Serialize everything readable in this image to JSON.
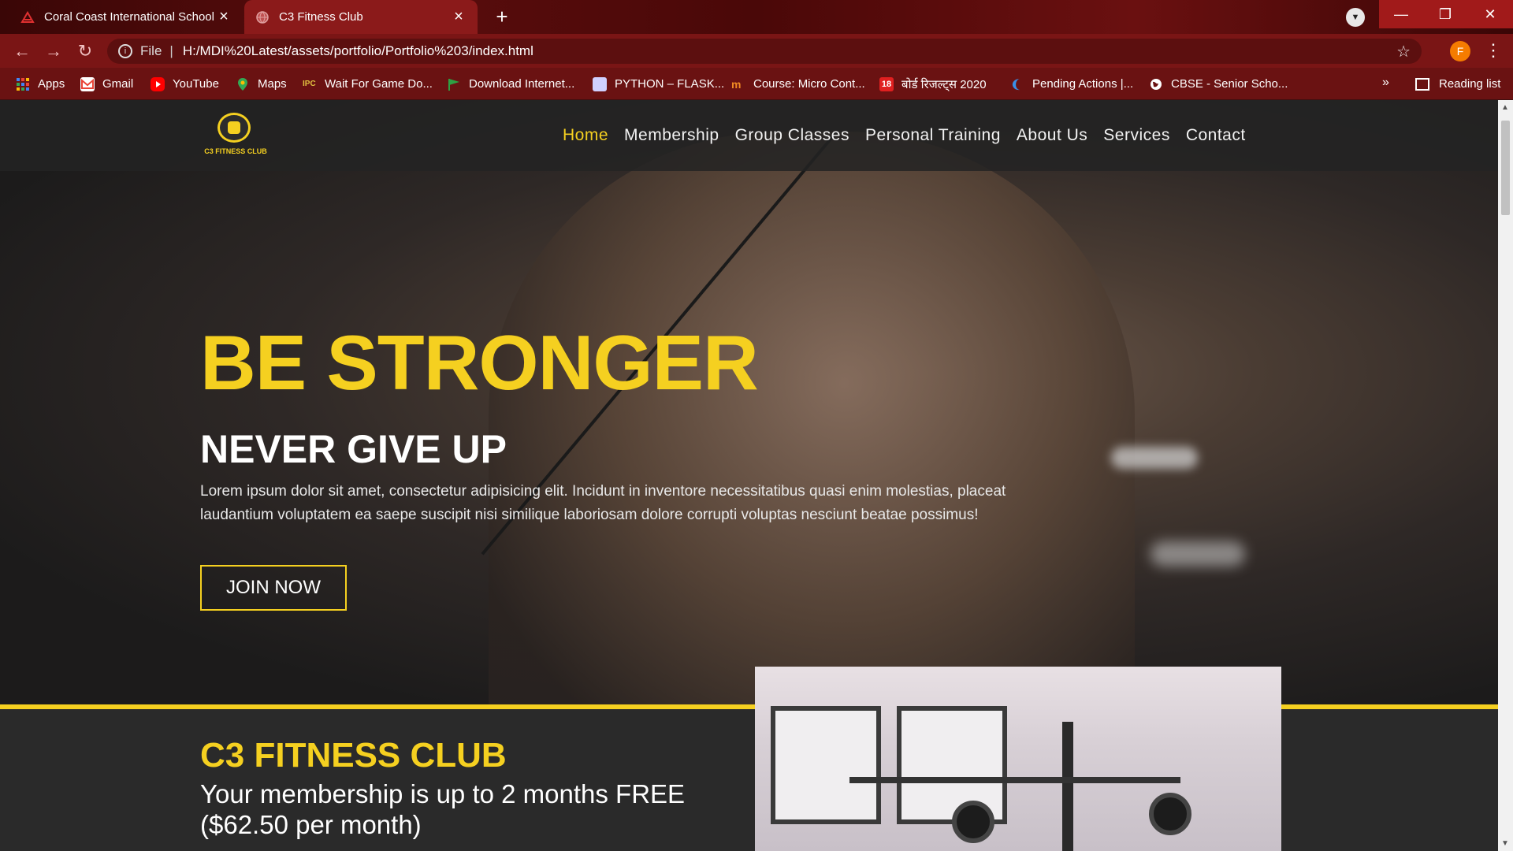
{
  "browser": {
    "tabs": [
      {
        "title": "Coral Coast International School",
        "active": false,
        "favicon": "school-favicon"
      },
      {
        "title": "C3 Fitness Club",
        "active": true,
        "favicon": "globe-favicon"
      }
    ],
    "new_tab_label": "+",
    "address": {
      "scheme_label": "File",
      "url": "H:/MDI%20Latest/assets/portfolio/Portfolio%203/index.html"
    },
    "profile_initial": "F",
    "bookmarks": [
      {
        "label": "Apps",
        "icon": "apps-grid-icon",
        "color": "#4285f4"
      },
      {
        "label": "Gmail",
        "icon": "gmail-icon",
        "color": "#ea4335"
      },
      {
        "label": "YouTube",
        "icon": "youtube-icon",
        "color": "#ff0000"
      },
      {
        "label": "Maps",
        "icon": "maps-pin-icon",
        "color": "#34a853"
      },
      {
        "label": "Wait For Game Do...",
        "icon": "ipc-games-icon",
        "color": "#e0c040"
      },
      {
        "label": "Download Internet...",
        "icon": "green-flag-icon",
        "color": "#2ea043"
      },
      {
        "label": "PYTHON – FLASK...",
        "icon": "python-flask-icon",
        "color": "#d0d0ff"
      },
      {
        "label": "Course: Micro Cont...",
        "icon": "moodle-icon",
        "color": "#f08a24"
      },
      {
        "label": "बोर्ड रिजल्ट्स 2020",
        "icon": "news18-icon",
        "color": "#e02020"
      },
      {
        "label": "Pending Actions |...",
        "icon": "moon-icon",
        "color": "#3a8ee6"
      },
      {
        "label": "CBSE - Senior Scho...",
        "icon": "globe-icon",
        "color": "#ffffff"
      }
    ],
    "bookmarks_overflow": "»",
    "reading_list": "Reading list"
  },
  "site": {
    "logo_text": "C3 FITNESS CLUB",
    "nav": [
      {
        "label": "Home",
        "active": true
      },
      {
        "label": "Membership",
        "active": false
      },
      {
        "label": "Group Classes",
        "active": false
      },
      {
        "label": "Personal Training",
        "active": false
      },
      {
        "label": "About Us",
        "active": false
      },
      {
        "label": "Services",
        "active": false
      },
      {
        "label": "Contact",
        "active": false
      }
    ],
    "hero": {
      "headline": "BE STRONGER",
      "subheadline": "NEVER GIVE UP",
      "lead": "Lorem ipsum dolor sit amet, consectetur adipisicing elit. Incidunt in inventore necessitatibus quasi enim molestias, placeat laudantium voluptatem ea saepe suscipit nisi similique laboriosam dolore corrupti voluptas nesciunt beatae possimus!",
      "cta": "JOIN NOW"
    },
    "about": {
      "title": "C3 FITNESS CLUB",
      "promo": "Your membership is up to 2 months FREE ($62.50 per month)"
    },
    "accent_color": "#f5d020"
  }
}
